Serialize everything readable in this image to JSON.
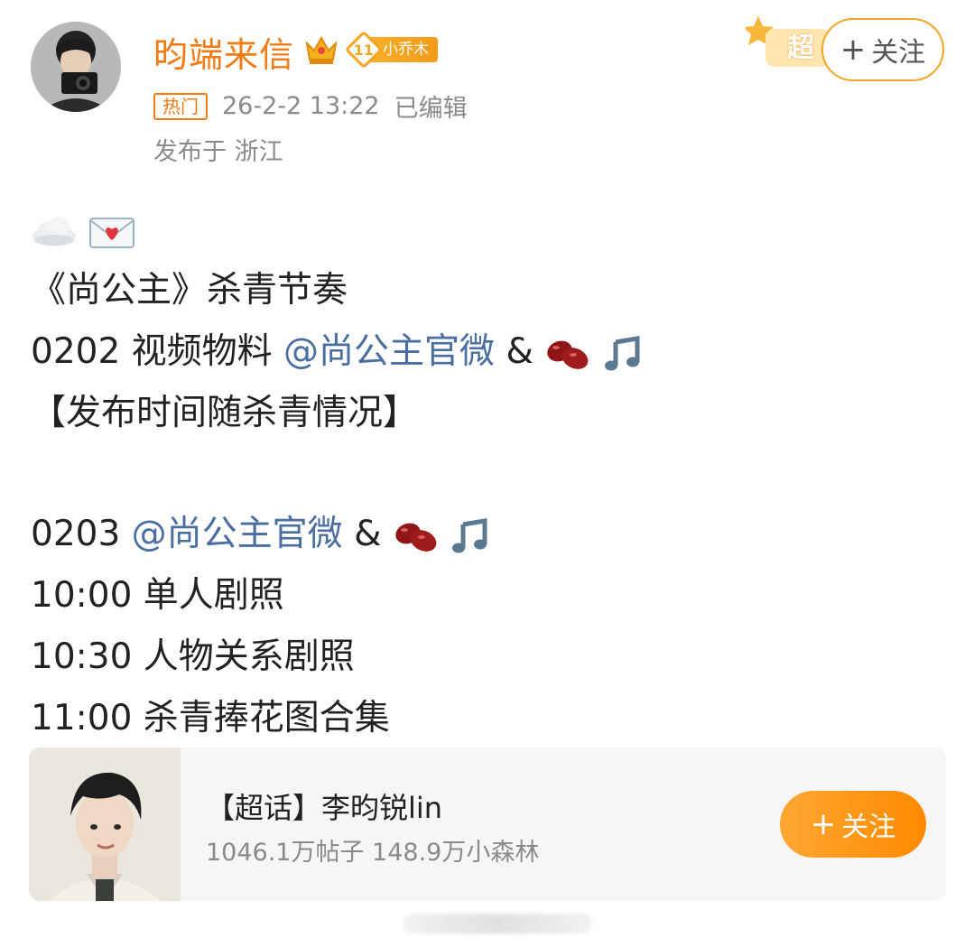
{
  "post": {
    "username": "昀端来信",
    "fan_badge": {
      "level": "11",
      "name": "小乔木"
    },
    "hot_tag": "热门",
    "timestamp": "26-2-2 13:22",
    "edited": "已编辑",
    "location": "发布于 浙江",
    "follow_plus": "+",
    "follow_label": "关注",
    "super_badge": "超",
    "content": {
      "emoji_line": [
        "cloud-emoji",
        "love-letter-emoji"
      ],
      "line1": "《尚公主》杀青节奏",
      "line2_prefix": "0202 视频物料 ",
      "line2_mention": "@尚公主官微",
      "line2_suffix": " &",
      "line3": "【发布时间随杀青情况】",
      "line4_prefix": "0203 ",
      "line4_mention": "@尚公主官微",
      "line4_suffix": " & ",
      "line5": "10:00 单人剧照",
      "line6": "10:30 人物关系剧照",
      "line7": "11:00 杀青捧花图合集"
    }
  },
  "card": {
    "title": "【超话】李昀锐lin",
    "stats": "1046.1万帖子 148.9万小森林",
    "follow_plus": "+",
    "follow_label": "关注"
  },
  "colors": {
    "accent": "#f07a13",
    "mention": "#4a6ea0",
    "muted": "#8a8a8a"
  }
}
